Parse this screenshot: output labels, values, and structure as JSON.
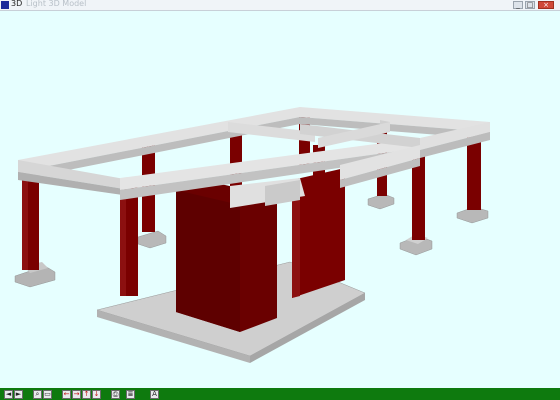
{
  "window": {
    "title": "3D",
    "title_faint": "Light 3D Model",
    "min_label": "_",
    "max_label": "□",
    "close_label": "×"
  },
  "scene": {
    "background": "#e6ffff",
    "column_color": "#7a0000",
    "beam_color": "#d4d4d4",
    "footing_color": "#b8b8b8",
    "slab_color": "#c8c8c8"
  },
  "toolbar": {
    "background": "#0e7a0e",
    "buttons": [
      {
        "icon": "rotate-left-icon",
        "glyph": "◄"
      },
      {
        "icon": "rotate-right-icon",
        "glyph": "►"
      },
      {
        "icon": "zoom-icon",
        "glyph": "⌕"
      },
      {
        "icon": "window-icon",
        "glyph": "▭"
      },
      {
        "icon": "pan-left-icon",
        "glyph": "←"
      },
      {
        "icon": "pan-right-icon",
        "glyph": "→"
      },
      {
        "icon": "pan-up-icon",
        "glyph": "↑"
      },
      {
        "icon": "pan-down-icon",
        "glyph": "↓"
      },
      {
        "icon": "print-icon",
        "glyph": "⎙"
      },
      {
        "icon": "document-icon",
        "glyph": "≣"
      },
      {
        "icon": "text-icon",
        "glyph": "A"
      }
    ]
  }
}
